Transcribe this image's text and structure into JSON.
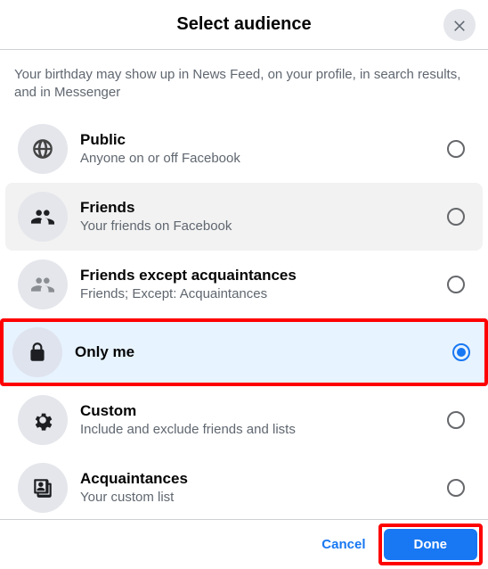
{
  "header": {
    "title": "Select audience"
  },
  "description": "Your birthday may show up in News Feed, on your profile, in search results, and in Messenger",
  "options": [
    {
      "title": "Public",
      "subtitle": "Anyone on or off Facebook"
    },
    {
      "title": "Friends",
      "subtitle": "Your friends on Facebook"
    },
    {
      "title": "Friends except acquaintances",
      "subtitle": "Friends; Except: Acquaintances"
    },
    {
      "title": "Only me",
      "subtitle": ""
    },
    {
      "title": "Custom",
      "subtitle": "Include and exclude friends and lists"
    },
    {
      "title": "Acquaintances",
      "subtitle": "Your custom list"
    }
  ],
  "footer": {
    "cancel": "Cancel",
    "done": "Done"
  }
}
